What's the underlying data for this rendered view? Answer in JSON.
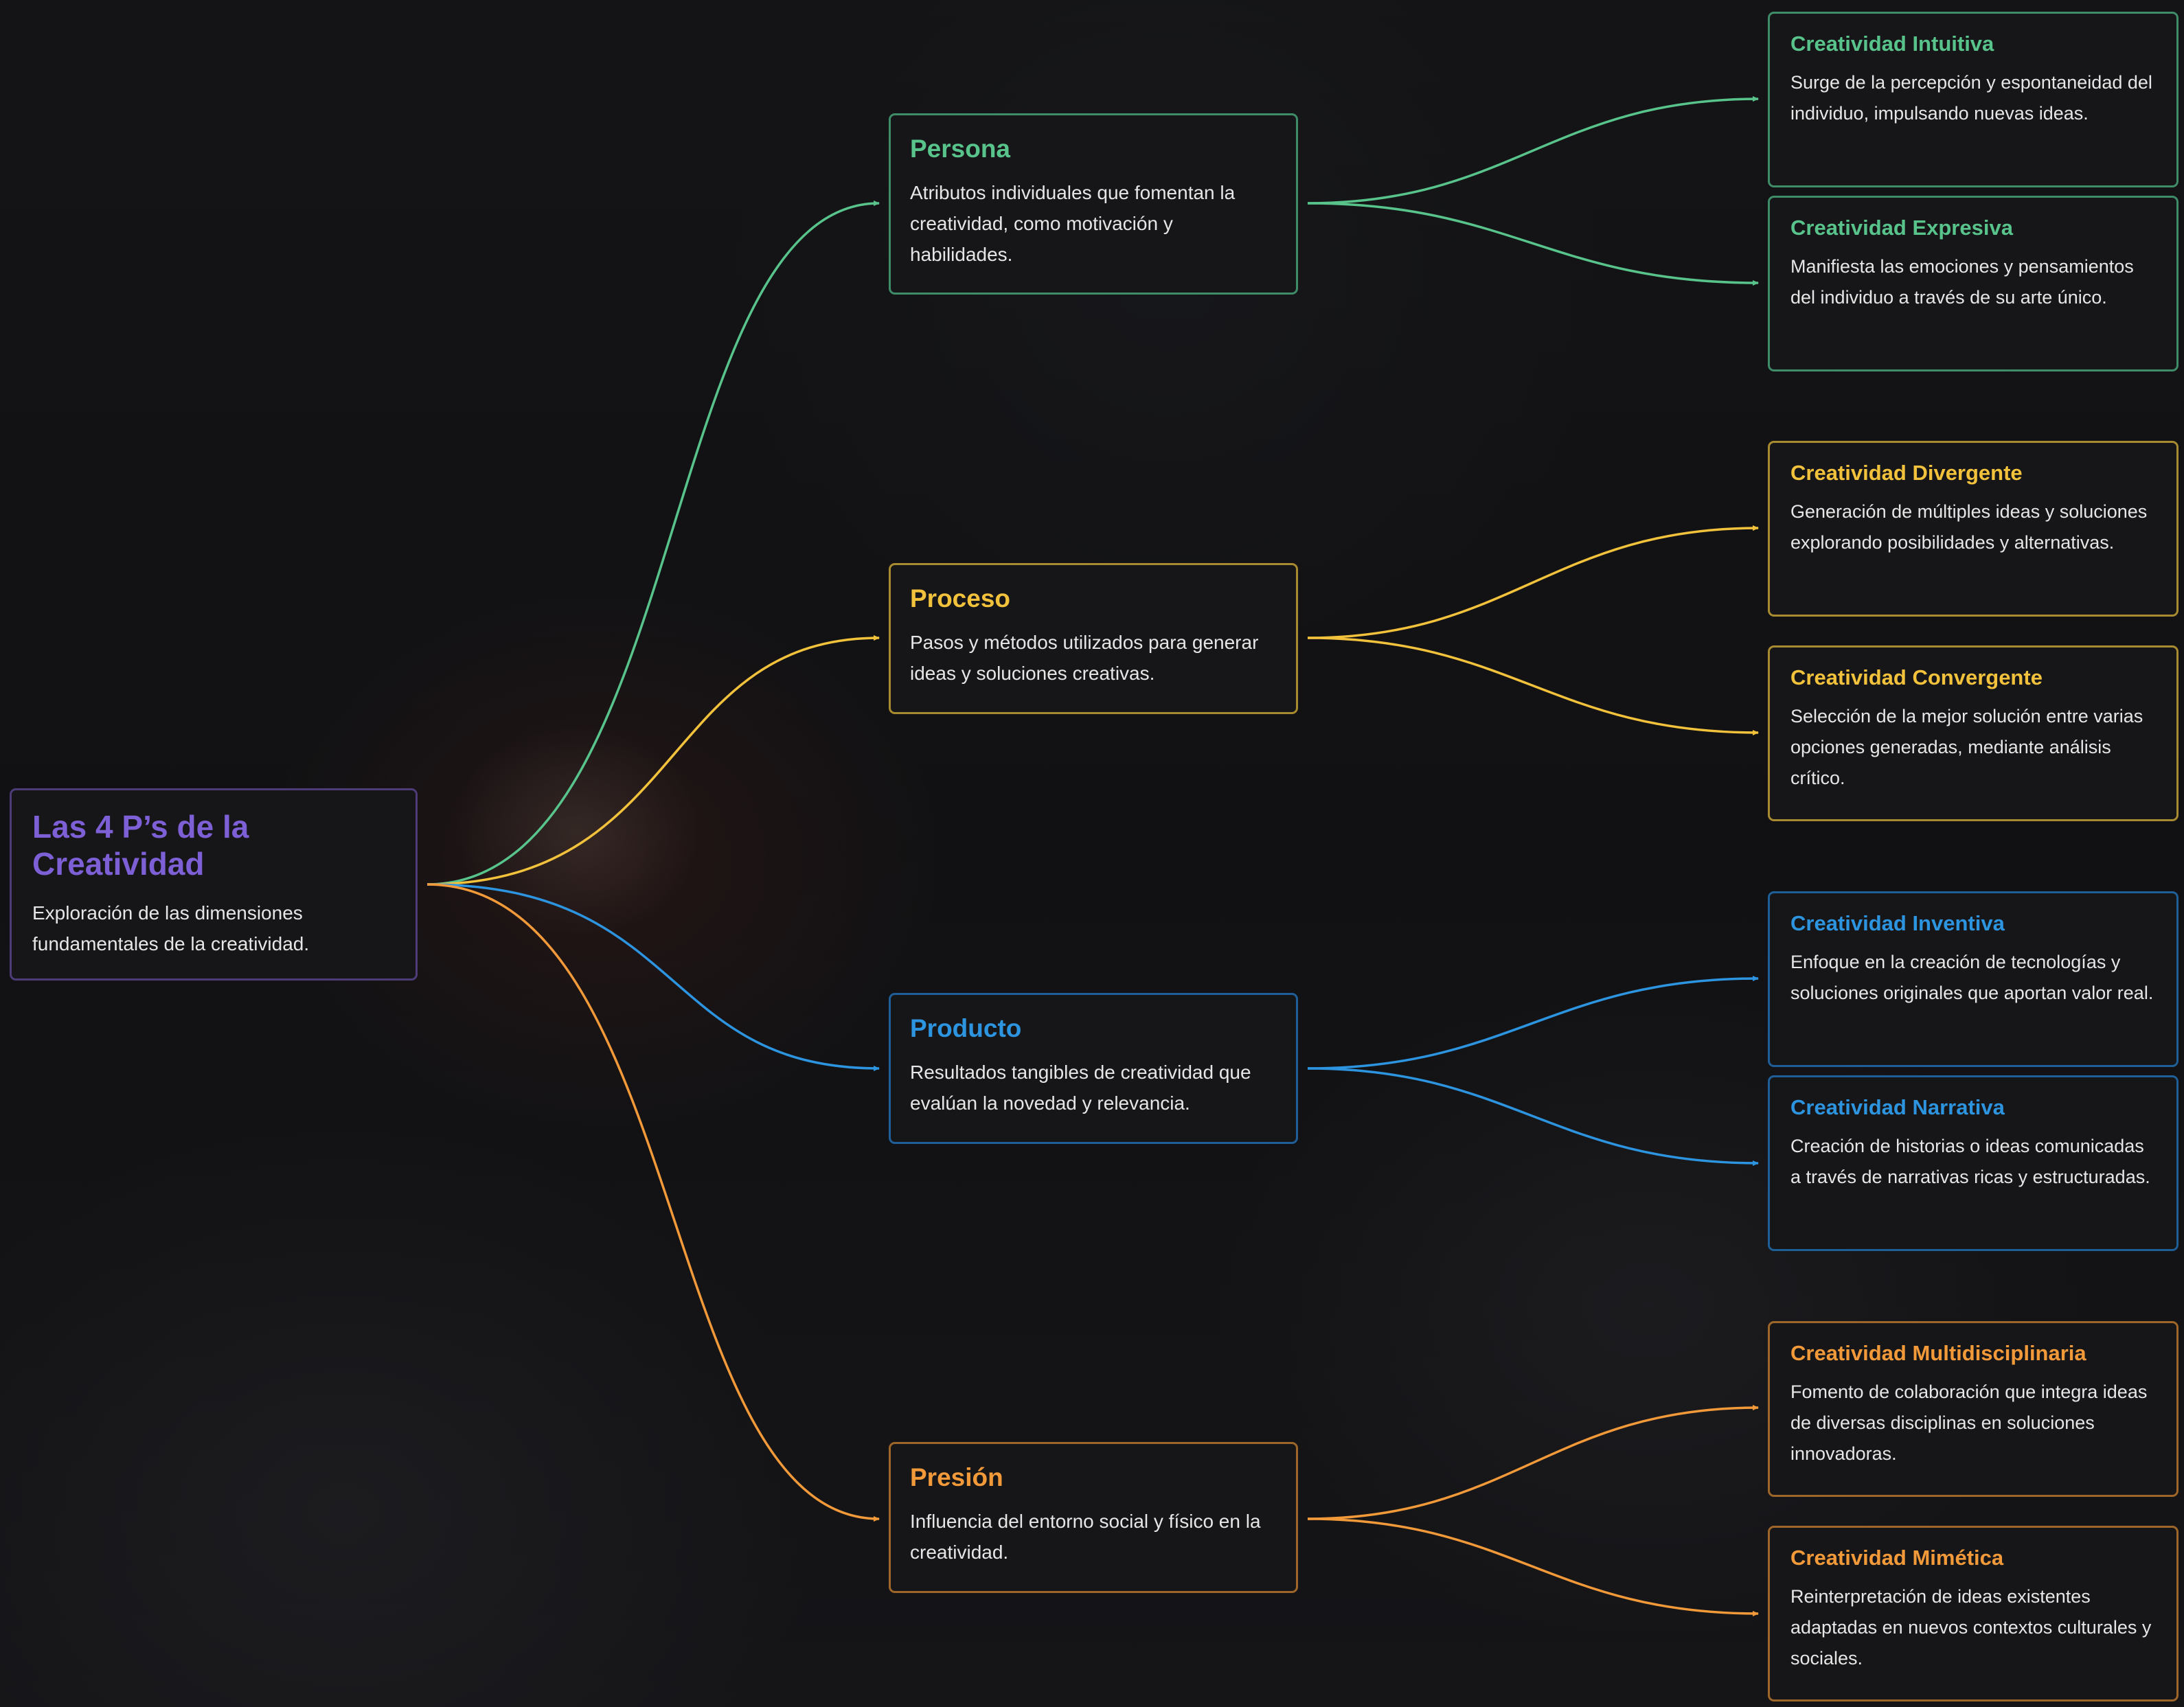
{
  "colors": {
    "root": "#7d5fd6",
    "persona": "#58c48c",
    "proceso": "#f2c23c",
    "producto": "#2d94e0",
    "presion": "#f29a3a",
    "background": "#121214",
    "node_fill": "#161618"
  },
  "root": {
    "title": "Las 4 P’s de la Creatividad",
    "description": "Exploración de las dimensiones fundamentales de la creatividad."
  },
  "categories": [
    {
      "title": "Persona",
      "description": "Atributos individuales que fomentan la creatividad, como motivación y habilidades.",
      "children": [
        {
          "title": "Creatividad Intuitiva",
          "description": "Surge de la percepción y espontaneidad del individuo, impulsando nuevas ideas."
        },
        {
          "title": "Creatividad Expresiva",
          "description": "Manifiesta las emociones y pensamientos del individuo a través de su arte único."
        }
      ]
    },
    {
      "title": "Proceso",
      "description": "Pasos y métodos utilizados para generar ideas y soluciones creativas.",
      "children": [
        {
          "title": "Creatividad Divergente",
          "description": "Generación de múltiples ideas y soluciones explorando posibilidades y alternativas."
        },
        {
          "title": "Creatividad Convergente",
          "description": "Selección de la mejor solución entre varias opciones generadas, mediante análisis crítico."
        }
      ]
    },
    {
      "title": "Producto",
      "description": "Resultados tangibles de creatividad que evalúan la novedad y relevancia.",
      "children": [
        {
          "title": "Creatividad Inventiva",
          "description": "Enfoque en la creación de tecnologías y soluciones originales que aportan valor real."
        },
        {
          "title": "Creatividad Narrativa",
          "description": "Creación de historias o ideas comunicadas a través de narrativas ricas y estructuradas."
        }
      ]
    },
    {
      "title": "Presión",
      "description": "Influencia del entorno social y físico en la creatividad.",
      "children": [
        {
          "title": "Creatividad Multidisciplinaria",
          "description": "Fomento de colaboración que integra ideas de diversas disciplinas en soluciones innovadoras."
        },
        {
          "title": "Creatividad Mimética",
          "description": "Reinterpretación de ideas existentes adaptadas en nuevos contextos culturales y sociales."
        }
      ]
    }
  ]
}
